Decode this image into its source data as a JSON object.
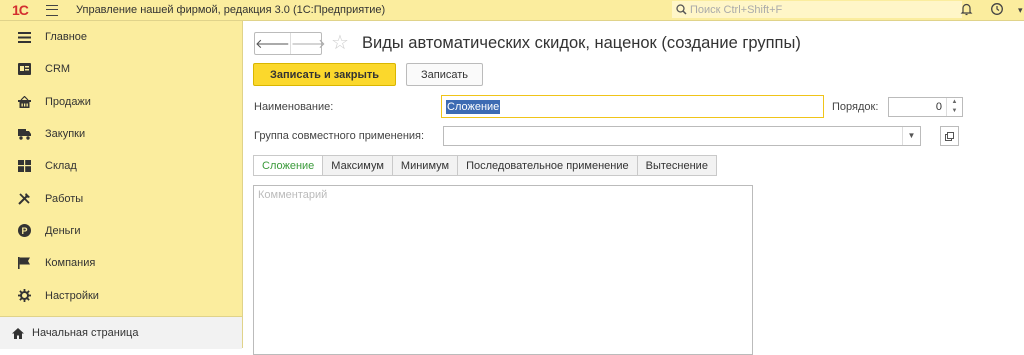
{
  "app": {
    "logo": "1С",
    "title": "Управление нашей фирмой, редакция 3.0  (1С:Предприятие)",
    "search_placeholder": "Поиск Ctrl+Shift+F"
  },
  "sidebar": {
    "items": [
      {
        "label": "Главное",
        "icon": "menu-lines-icon"
      },
      {
        "label": "CRM",
        "icon": "crm-card-icon"
      },
      {
        "label": "Продажи",
        "icon": "shop-basket-icon"
      },
      {
        "label": "Закупки",
        "icon": "truck-icon"
      },
      {
        "label": "Склад",
        "icon": "warehouse-icon"
      },
      {
        "label": "Работы",
        "icon": "tools-icon"
      },
      {
        "label": "Деньги",
        "icon": "coin-icon"
      },
      {
        "label": "Компания",
        "icon": "flag-icon"
      },
      {
        "label": "Настройки",
        "icon": "gear-icon"
      }
    ],
    "home_label": "Начальная страница"
  },
  "form": {
    "title": "Виды автоматических скидок, наценок (создание группы)",
    "save_close_label": "Записать и закрыть",
    "save_label": "Записать",
    "name_label": "Наименование:",
    "name_value": "Сложение",
    "order_label": "Порядок:",
    "order_value": "0",
    "group_label": "Группа совместного применения:",
    "group_value": "",
    "tabs": [
      {
        "label": "Сложение",
        "active": true
      },
      {
        "label": "Максимум",
        "active": false
      },
      {
        "label": "Минимум",
        "active": false
      },
      {
        "label": "Последовательное применение",
        "active": false
      },
      {
        "label": "Вытеснение",
        "active": false
      }
    ],
    "comment_placeholder": "Комментарий"
  },
  "colors": {
    "sidebar_bg": "#fbed9e",
    "primary_button": "#fbd82c",
    "active_tab_text": "#3a9a3a",
    "selection": "#3d6bb3"
  }
}
